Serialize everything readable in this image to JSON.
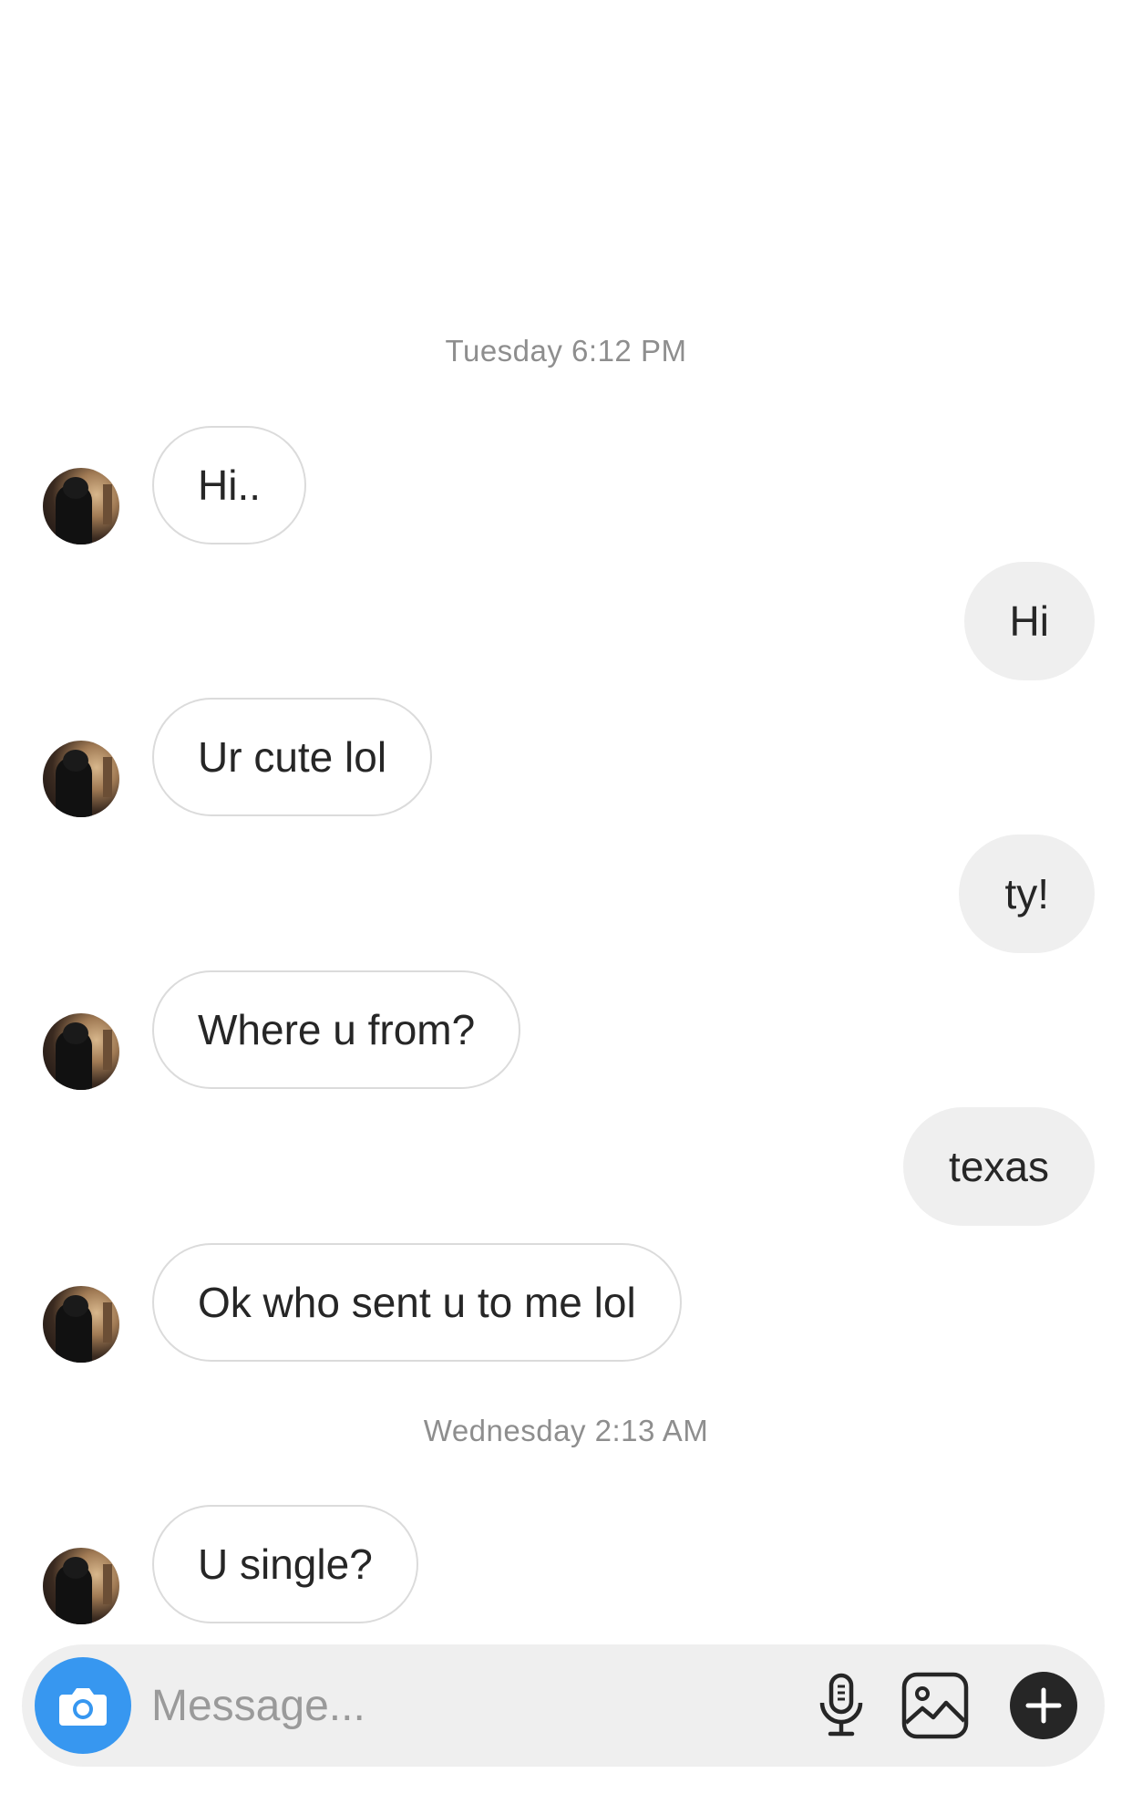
{
  "thread": {
    "timestamps": [
      "Tuesday 6:12 PM",
      "Wednesday 2:13 AM"
    ],
    "messages": [
      {
        "from": "them",
        "text": "Hi.."
      },
      {
        "from": "me",
        "text": "Hi"
      },
      {
        "from": "them",
        "text": "Ur cute lol"
      },
      {
        "from": "me",
        "text": "ty!"
      },
      {
        "from": "them",
        "text": "Where u from?"
      },
      {
        "from": "me",
        "text": "texas"
      },
      {
        "from": "them",
        "text": "Ok who sent u to me lol"
      },
      {
        "from": "them",
        "text": "U single?"
      }
    ]
  },
  "composer": {
    "placeholder": "Message...",
    "icons": [
      "camera-icon",
      "microphone-icon",
      "gallery-icon",
      "plus-icon"
    ]
  },
  "colors": {
    "accent": "#3797f0",
    "incoming_border": "#dbdbdb",
    "outgoing_bg": "#efefef",
    "timestamp": "#8e8e8e"
  }
}
